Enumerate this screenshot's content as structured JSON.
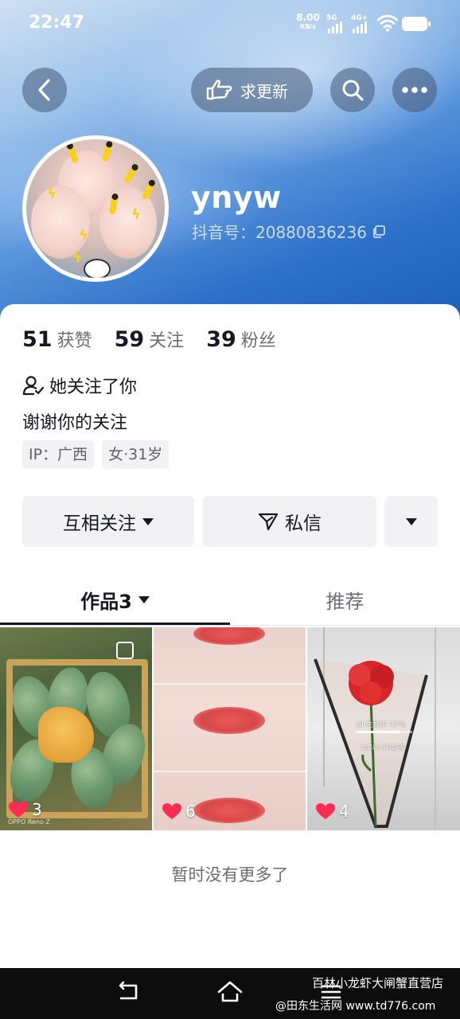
{
  "status_bar": {
    "time": "22:47",
    "net_speed_value": "8.00",
    "net_speed_unit": "KB/s",
    "sim1_label": "5G",
    "sim2_label": "4G+",
    "wifi_icon": "wifi-icon",
    "battery_icon": "battery-icon"
  },
  "header": {
    "back_icon": "back-chevron-icon",
    "request_update_label": "求更新",
    "request_icon": "pointing-hand-icon",
    "search_icon": "search-icon",
    "more_icon": "more-dots-icon"
  },
  "profile": {
    "username": "ynyw",
    "douyin_id": "抖音号：20880836236",
    "copy_icon": "copy-icon",
    "likes_count": "51",
    "likes_label": "获赞",
    "following_count": "59",
    "following_label": "关注",
    "followers_count": "39",
    "followers_label": "粉丝",
    "follows_you_text": "她关注了你",
    "bio": "谢谢你的关注",
    "tags": [
      "IP：广西",
      "女·31岁"
    ]
  },
  "actions": {
    "mutual_follow_label": "互相关注",
    "message_label": "私信"
  },
  "tabs": {
    "works_label": "作品3",
    "recommend_label": "推荐"
  },
  "works": [
    {
      "likes": "3",
      "watermark": "OPPO Reno Z"
    },
    {
      "likes": "6"
    },
    {
      "likes": "4",
      "overlay_progress": "AI 生成中 77%",
      "overlay_caption": "新春风 | 祥瑞祝福"
    }
  ],
  "footer": {
    "no_more_text": "暂时没有更多了"
  },
  "watermark": {
    "line1": "百林小龙虾大闸蟹直营店",
    "line2": "@田东生活网 www.td776.com"
  },
  "colors": {
    "header_blue": "#2c70c9",
    "heart_red": "#fe2c55",
    "text_primary": "#161823",
    "text_secondary": "#6b6d75"
  }
}
